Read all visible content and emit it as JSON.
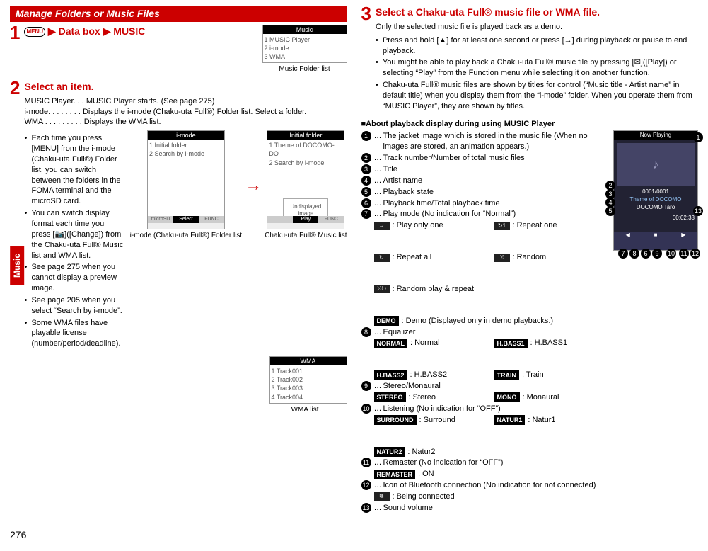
{
  "sideTab": "Music",
  "pageNumber": "276",
  "left": {
    "sectionHead": "Manage Folders or Music Files",
    "step1": {
      "num": "1",
      "breadcrumb": {
        "menuKey": "MENU",
        "sep": "▶",
        "a": "Data box",
        "b": "MUSIC"
      },
      "figCap": "Music Folder list",
      "figLines": [
        "1 MUSIC Player",
        "2 i-mode",
        "3 WMA"
      ],
      "figTitle": "Music"
    },
    "step2": {
      "num": "2",
      "title": "Select an item.",
      "lines": [
        "MUSIC Player. . . MUSIC Player starts. (See page 275)",
        "i-mode. . . . . . . . Displays the i-mode (Chaku-uta Full®) Folder list. Select a folder.",
        "WMA . . . . . . . . . Displays the WMA list."
      ],
      "bulletsA": [
        "Each time you press [MENU] from the i-mode (Chaku-uta Full®) Folder list, you can switch between the folders in the FOMA terminal and the microSD card.",
        "You can switch display format each time you press [📷]([Change]) from the Chaku-uta Full® Music list and WMA list.",
        "See page 275 when you cannot display a preview image.",
        "See page 205 when you select “Search by i-mode”.",
        "Some WMA files have playable license (number/period/deadline)."
      ],
      "fig1Cap": "i-mode (Chaku-uta Full®) Folder list",
      "fig1Title": "i-mode",
      "fig1Lines": [
        "1 Initial folder",
        "2 Search by i-mode"
      ],
      "fig2Cap": "Chaku-uta Full® Music list",
      "fig2Title": "Initial folder",
      "fig2Lines": [
        "1 Theme of DOCOMO-DO",
        "2 Search by i-mode",
        "",
        "Undisplayed image"
      ],
      "wmaCap": "WMA list",
      "wmaTitle": "WMA",
      "wmaLines": [
        "1 Track001",
        "2 Track002",
        "3 Track003",
        "4 Track004"
      ]
    }
  },
  "right": {
    "step3": {
      "num": "3",
      "title": "Select a Chaku-uta Full® music file or WMA file.",
      "intro": "Only the selected music file is played back as a demo.",
      "bullets": [
        "Press and hold [▲] for at least one second or press [→] during playback or pause to end playback.",
        "You might be able to play back a Chaku-uta Full® music file by pressing [✉]([Play]) or selecting “Play” from the Function menu while selecting it on another function.",
        "Chaku-uta Full® music files are shown by titles for control (“Music title - Artist name” in default title) when you display them from the “i-mode” folder. When you operate them from “MUSIC Player”, they are shown by titles."
      ]
    },
    "aboutHead": "About playback display during using MUSIC Player",
    "items": [
      {
        "n": "1",
        "text": "The jacket image which is stored in the music file (When no images are stored, an animation appears.)"
      },
      {
        "n": "2",
        "text": "Track number/Number of total music files"
      },
      {
        "n": "3",
        "text": "Title"
      },
      {
        "n": "4",
        "text": "Artist name"
      },
      {
        "n": "5",
        "text": "Playback state"
      },
      {
        "n": "6",
        "text": "Playback time/Total playback time"
      },
      {
        "n": "7",
        "text": "Play mode (No indication for “Normal”)",
        "sub": [
          {
            "icon": "→",
            "label": ": Play only one"
          },
          {
            "icon": "↻1",
            "label": ": Repeat one"
          },
          {
            "icon": "↻",
            "label": ": Repeat all"
          },
          {
            "icon": "⤨",
            "label": ": Random"
          },
          {
            "icon": "⤨↻",
            "label": ": Random play & repeat"
          },
          {
            "icon": "DEMO",
            "label": ": Demo (Displayed only in demo playbacks.)",
            "inv": true
          }
        ]
      },
      {
        "n": "8",
        "text": "Equalizer",
        "sub": [
          {
            "icon": "NORMAL",
            "label": ": Normal",
            "inv": true
          },
          {
            "icon": "H.BASS1",
            "label": ": H.BASS1",
            "inv": true
          },
          {
            "icon": "H.BASS2",
            "label": ": H.BASS2",
            "inv": true
          },
          {
            "icon": "TRAIN",
            "label": ": Train",
            "inv": true
          }
        ]
      },
      {
        "n": "9",
        "text": "Stereo/Monaural",
        "sub": [
          {
            "icon": "STEREO",
            "label": ": Stereo",
            "inv": true
          },
          {
            "icon": "MONO",
            "label": ": Monaural",
            "inv": true
          }
        ]
      },
      {
        "n": "10",
        "text": "Listening (No indication for “OFF”)",
        "sub": [
          {
            "icon": "SURROUND",
            "label": ": Surround",
            "inv": true
          },
          {
            "icon": "NATUR1",
            "label": ": Natur1",
            "inv": true
          },
          {
            "icon": "NATUR2",
            "label": ": Natur2",
            "inv": true
          }
        ]
      },
      {
        "n": "11",
        "text": "Remaster (No indication for “OFF”)",
        "sub": [
          {
            "icon": "REMASTER",
            "label": ": ON",
            "inv": true
          }
        ]
      },
      {
        "n": "12",
        "text": "Icon of Bluetooth connection (No indication for not connected)",
        "sub": [
          {
            "icon": "⧉",
            "label": ": Being connected"
          }
        ]
      },
      {
        "n": "13",
        "text": "Sound volume"
      }
    ],
    "playerFig": {
      "title": "Now Playing",
      "track": "0001/0001",
      "song": "Theme of DOCOMO",
      "artist": "DOCOMO Taro",
      "time": "00:02:33"
    }
  }
}
